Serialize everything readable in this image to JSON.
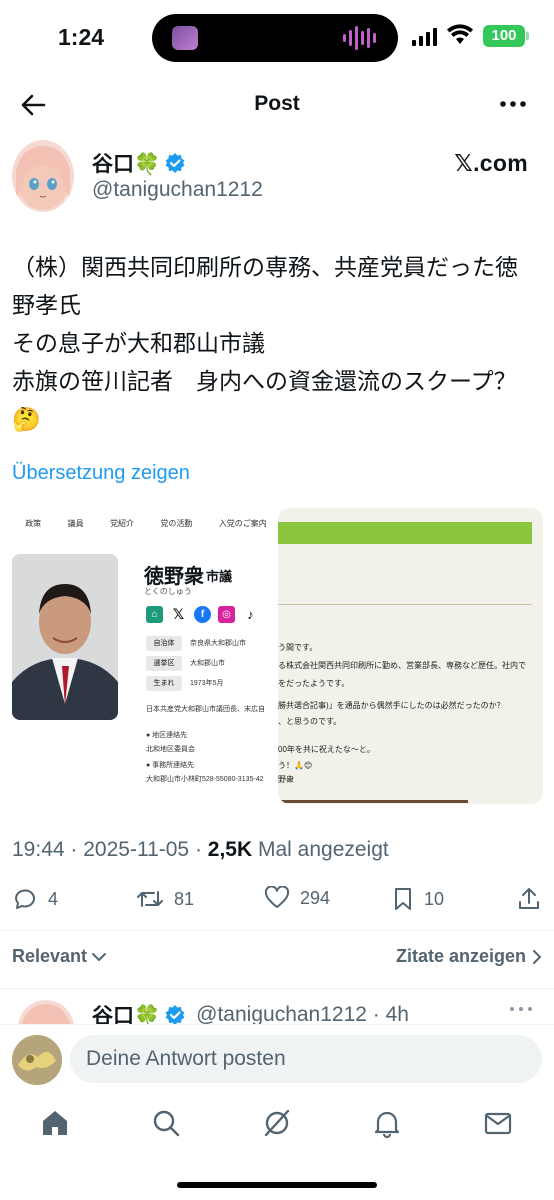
{
  "status_bar": {
    "time": "1:24",
    "battery": "100"
  },
  "header": {
    "title": "Post"
  },
  "author": {
    "name": "谷口🍀",
    "handle": "@taniguchan1212",
    "source": "𝕏.com"
  },
  "tweet": {
    "lines": [
      "（株）関西共同印刷所の専務、共産党員だった徳",
      "野孝氏",
      "その息子が大和郡山市議",
      "赤旗の笹川記者　身内への資金還流のスクープ？",
      "🤔"
    ],
    "translate_link": "Übersetzung zeigen"
  },
  "media": {
    "nav_items": [
      "政策",
      "議員",
      "党紹介",
      "党の活動",
      "入党のご案内"
    ],
    "candidate_name": "徳野衆",
    "candidate_role": "市議",
    "candidate_kana": "とくのしゅう",
    "info": [
      {
        "key": "自治体",
        "value": "奈良県大和郡山市"
      },
      {
        "key": "選挙区",
        "value": "大和郡山市"
      },
      {
        "key": "生まれ",
        "value": "1973年5月"
      }
    ],
    "bio": "日本共産党大和郡山市議団長、末広自",
    "contact_label1": "● 地区連絡先",
    "contact_value1": "北和地区委員会",
    "contact_label2": "● 事務所連絡先",
    "contact_value2": "大和郡山市小林町528-55080-3135-42",
    "right_lines": [
      "う間です。",
      "る株式会社関西共同印刷所に勤め、営業部長、専務など歴任。社内で",
      "をだったようです。",
      "勝共選合記事)」を通品から偶然手にしたのは必然だったのか？",
      "、と思うのです。",
      "00年を共に祝えたな〜と。",
      "う！🙏😊",
      "野衆"
    ]
  },
  "meta": {
    "time": "19:44",
    "date": "2025-11-05",
    "views": "2,5K",
    "views_suffix": "Mal angezeigt"
  },
  "actions": {
    "replies": "4",
    "reposts": "81",
    "likes": "294",
    "bookmarks": "10"
  },
  "sort": {
    "left": "Relevant",
    "right": "Zitate anzeigen"
  },
  "reply_preview": {
    "name": "谷口🍀",
    "handle": "@taniguchan1212 · 4h"
  },
  "compose": {
    "placeholder": "Deine Antwort posten"
  },
  "colors": {
    "accent": "#1d9bf0",
    "verified": "#1d9bf0",
    "battery": "#34c759"
  }
}
